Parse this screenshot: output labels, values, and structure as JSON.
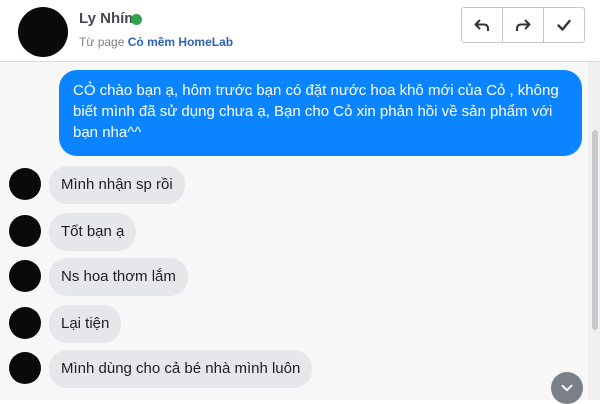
{
  "header": {
    "contact_name": "Ly Nhím",
    "source_prefix": "Từ page",
    "page_name": "Cỏ mềm HomeLab",
    "online": true,
    "online_color": "#31a24c"
  },
  "actions": [
    {
      "icon": "reply-icon"
    },
    {
      "icon": "forward-icon"
    },
    {
      "icon": "checkmark-icon"
    }
  ],
  "messages": [
    {
      "from": "page",
      "text": "CỎ chào bạn ạ, hôm trước bạn có đặt nước hoa khô mới của Cỏ , không biết mình đã sử dụng chưa ạ, Bạn cho Cỏ xin phản hồi về sản phẩm với bạn nha^^"
    },
    {
      "from": "customer",
      "text": "Mình nhận sp rồi"
    },
    {
      "from": "customer",
      "text": "Tốt bạn ạ"
    },
    {
      "from": "customer",
      "text": "Ns hoa thơm lắm"
    },
    {
      "from": "customer",
      "text": "Lại tiện"
    },
    {
      "from": "customer",
      "text": "Mình dùng cho cả bé nhà mình luôn"
    }
  ],
  "colors": {
    "outgoing_bubble": "#0b84ff",
    "incoming_bubble": "#e6e7eb",
    "page_link": "#2e62b8"
  }
}
